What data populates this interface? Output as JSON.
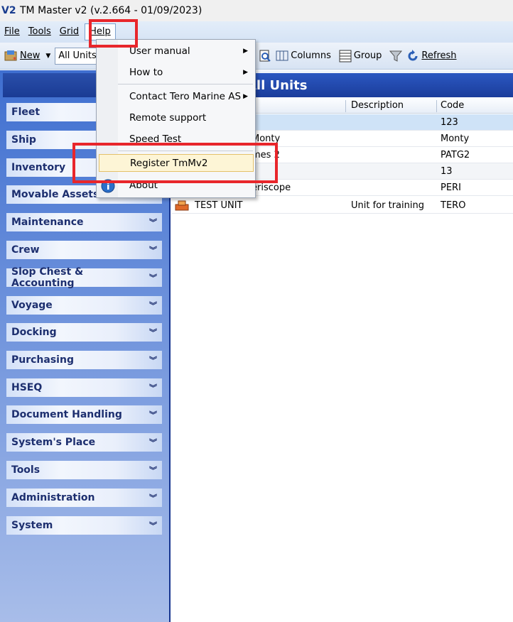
{
  "titlebar": {
    "logo": "V2",
    "title": "TM Master v2 (v.2.664 - 01/09/2023)"
  },
  "menubar": {
    "items": [
      "File",
      "Tools",
      "Grid",
      "Help"
    ]
  },
  "toolbar": {
    "new_label": "New",
    "selector_value": "All Units",
    "columns_label": "Columns",
    "group_label": "Group",
    "refresh_label": "Refresh"
  },
  "grid": {
    "title": "All Units",
    "columns": [
      "Description",
      "Code"
    ],
    "rows": [
      {
        "name": "",
        "description": "",
        "code": "123"
      },
      {
        "name": "Monty",
        "description": "",
        "code": "Monty"
      },
      {
        "name": "mes 2",
        "description": "",
        "code": "PATG2"
      },
      {
        "name": "",
        "description": "",
        "code": "13"
      },
      {
        "name": "eriscope",
        "description": "",
        "code": "PERI"
      },
      {
        "name": "TEST UNIT",
        "description": "Unit for training",
        "code": "TERO"
      }
    ]
  },
  "help_menu": {
    "user_manual": "User manual",
    "how_to": "How to",
    "contact": "Contact Tero Marine AS",
    "remote_support": "Remote support",
    "speed_test": "Speed Test",
    "register": "Register TmMv2",
    "about": "About"
  },
  "sidebar": {
    "items": [
      "Fleet",
      "Ship",
      "Inventory",
      "Movable Assets",
      "Maintenance",
      "Crew",
      "Slop Chest & Accounting",
      "Voyage",
      "Docking",
      "Purchasing",
      "HSEQ",
      "Document Handling",
      "System's Place",
      "Tools",
      "Administration",
      "System"
    ]
  },
  "colors": {
    "highlight_red": "#e8262b",
    "panel_blue": "#1b3d9b"
  }
}
